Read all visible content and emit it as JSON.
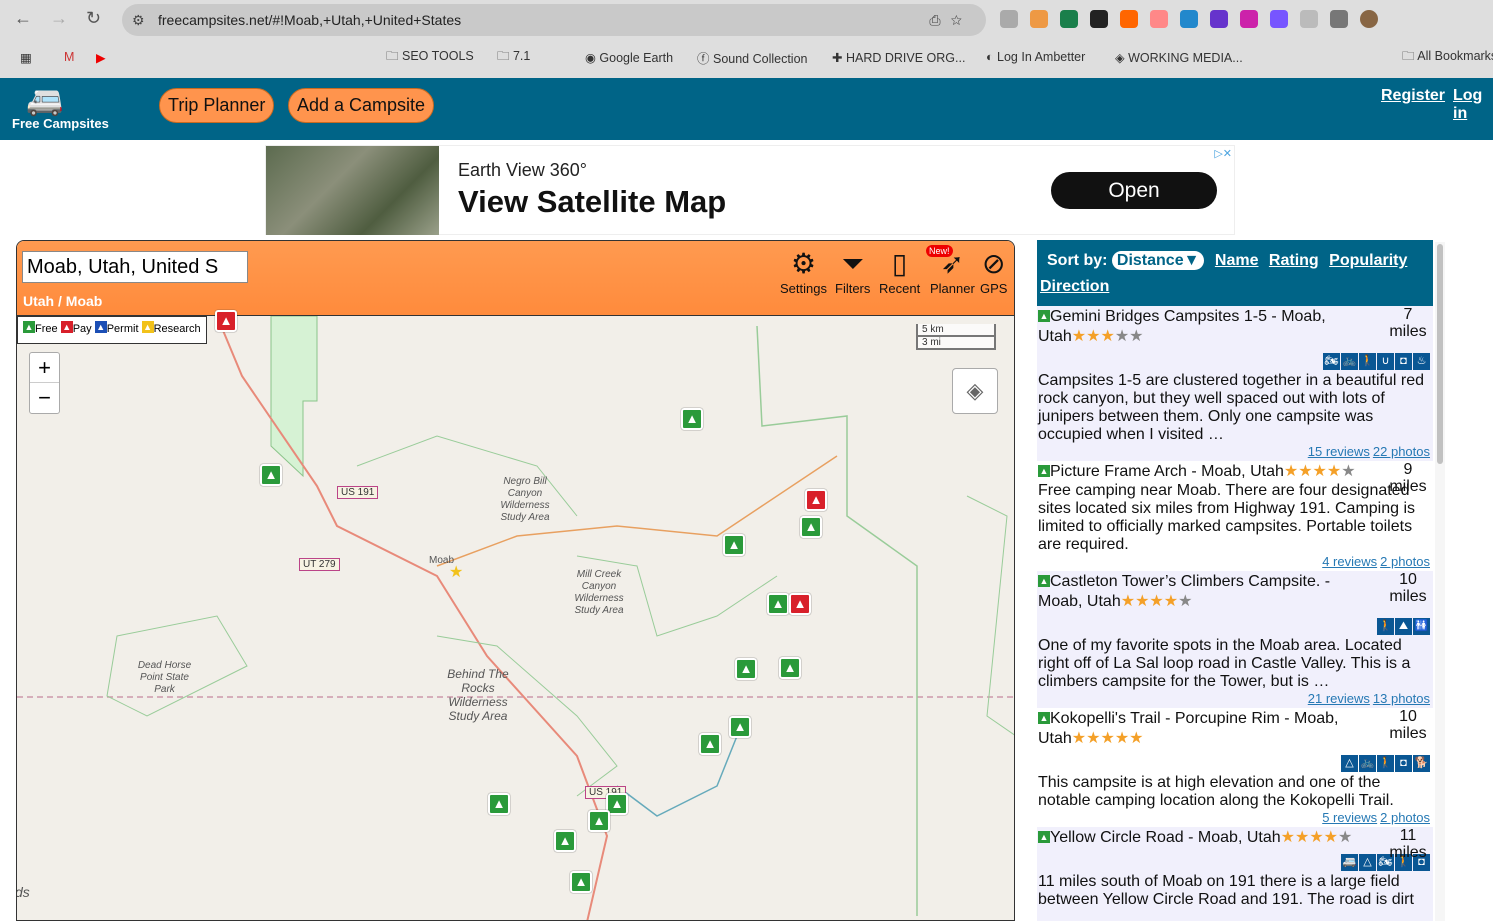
{
  "browser": {
    "url": "freecampsites.net/#!Moab,+Utah,+United+States",
    "bookmarks": [
      "SEO TOOLS",
      "7.1",
      "Google Earth",
      "Sound Collection",
      "HARD DRIVE ORG...",
      "Log In Ambetter",
      "WORKING MEDIA...",
      "All Bookmarks"
    ]
  },
  "header": {
    "logo": "Free Campsites",
    "trip_planner": "Trip Planner",
    "add_campsite": "Add a Campsite",
    "register": "Register",
    "login": "Log in"
  },
  "ad": {
    "subtitle": "Earth View 360°",
    "title": "View Satellite Map",
    "button": "Open"
  },
  "map": {
    "search_value": "Moab, Utah, United S",
    "breadcrumb": "Utah / Moab",
    "tools": [
      {
        "label": "Settings",
        "icon": "gear-icon"
      },
      {
        "label": "Filters",
        "icon": "funnel-icon"
      },
      {
        "label": "Recent",
        "icon": "save-icon"
      },
      {
        "label": "Planner",
        "icon": "planner-icon",
        "badge": "New!"
      },
      {
        "label": "GPS",
        "icon": "gps-off-icon"
      }
    ],
    "legend": [
      {
        "label": "Free",
        "color": "#2a9a3a"
      },
      {
        "label": "Pay",
        "color": "#d8202a"
      },
      {
        "label": "Permit",
        "color": "#1c4fb5"
      },
      {
        "label": "Research",
        "color": "#f2c21b"
      }
    ],
    "zoom_in": "+",
    "zoom_out": "−",
    "scale_km": "5 km",
    "scale_mi": "3 mi",
    "labels": [
      "Negro Bill Canyon Wilderness Study Area",
      "Moab",
      "Mill Creek Canyon Wilderness Study Area",
      "Dead Horse Point State Park",
      "Behind The Rocks Wilderness Study Area",
      "ds"
    ],
    "shields": [
      "US 191",
      "UT 279",
      "US 191"
    ]
  },
  "sidebar": {
    "sort_label": "Sort by:",
    "sort_selected": "Distance▼",
    "sort_options": [
      "Name",
      "Rating",
      "Popularity",
      "Direction"
    ],
    "items": [
      {
        "title": "Gemini Bridges Campsites 1-5 - Moab, Utah",
        "rating": 3,
        "distance": "7",
        "unit": "miles",
        "amenities": [
          "atv-icon",
          "bike-icon",
          "hiking-icon",
          "horseshoe-icon",
          "binoculars-icon",
          "campfire-icon"
        ],
        "description": "Campsites 1-5 are clustered together in a beautiful red rock canyon, but they well spaced out with lots of junipers between them. Only one campsite was occupied when I visited …",
        "reviews": "15 reviews",
        "photos": "22 photos"
      },
      {
        "title": "Picture Frame Arch - Moab, Utah",
        "rating": 3.5,
        "distance": "9",
        "unit": "miles",
        "amenities": [],
        "description": "Free camping near Moab. There are four designated sites located six miles from Highway 191. Camping is limited to officially marked campsites. Portable toilets are required.",
        "reviews": "4 reviews",
        "photos": "2 photos"
      },
      {
        "title": "Castleton Tower’s Climbers Campsite. - Moab, Utah",
        "rating": 3.5,
        "distance": "10",
        "unit": "miles",
        "amenities": [
          "hiking-icon",
          "climbing-icon",
          "restroom-icon"
        ],
        "description": "One of my favorite spots in the Moab area. Located right off of La Sal loop road in Castle Valley. This is a climbers campsite for the Tower, but is …",
        "reviews": "21 reviews",
        "photos": "13 photos"
      },
      {
        "title": "Kokopelli's Trail - Porcupine Rim - Moab, Utah",
        "rating": 4.5,
        "distance": "10",
        "unit": "miles",
        "amenities": [
          "tent-icon",
          "bike-icon",
          "hiking-icon",
          "binoculars-icon",
          "dog-icon"
        ],
        "description": "This campsite is at high elevation and one of the notable camping location along the Kokopelli Trail.",
        "reviews": "5 reviews",
        "photos": "2 photos"
      },
      {
        "title": "Yellow Circle Road - Moab, Utah",
        "rating": 3.5,
        "distance": "11",
        "unit": "miles",
        "amenities": [
          "trailer-icon",
          "tent-icon",
          "atv-icon",
          "hiking-icon",
          "binoculars-icon"
        ],
        "description": "11 miles south of Moab on 191 there is a large field between Yellow Circle Road and 191. The road is dirt",
        "reviews": "",
        "photos": ""
      }
    ]
  }
}
